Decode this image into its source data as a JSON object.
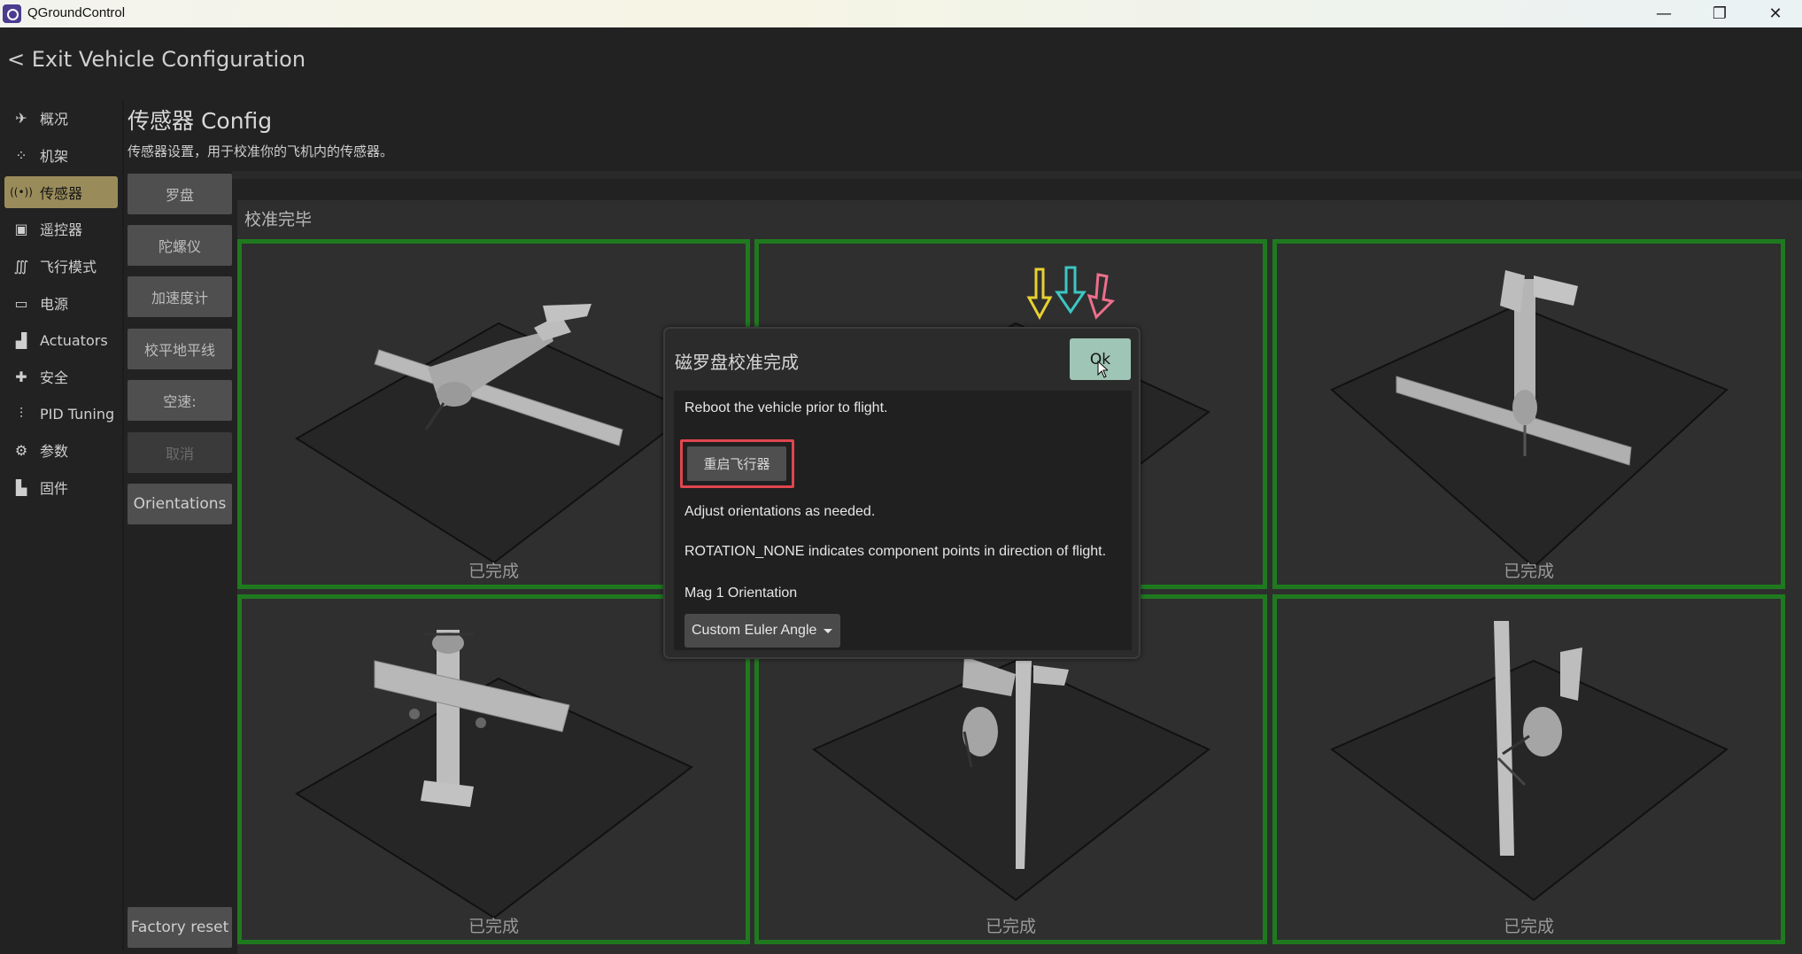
{
  "window": {
    "title": "QGroundControl",
    "minimize_icon": "—",
    "maximize_icon": "❐",
    "close_icon": "✕"
  },
  "header": {
    "exit_label": "< Exit Vehicle Configuration"
  },
  "sidebar": {
    "items": [
      {
        "label": "概况",
        "icon": "paper-plane-icon",
        "glyph": "✈"
      },
      {
        "label": "机架",
        "icon": "airframe-icon",
        "glyph": "⁘"
      },
      {
        "label": "传感器",
        "icon": "radio-waves-icon",
        "glyph": "((•))",
        "active": true
      },
      {
        "label": "遥控器",
        "icon": "gamepad-icon",
        "glyph": "▣"
      },
      {
        "label": "飞行模式",
        "icon": "waveform-icon",
        "glyph": "∭"
      },
      {
        "label": "电源",
        "icon": "battery-icon",
        "glyph": "▭"
      },
      {
        "label": "Actuators",
        "icon": "actuator-icon",
        "glyph": "▟"
      },
      {
        "label": "安全",
        "icon": "medkit-icon",
        "glyph": "✚"
      },
      {
        "label": "PID Tuning",
        "icon": "sliders-icon",
        "glyph": "⫶"
      },
      {
        "label": "参数",
        "icon": "gears-icon",
        "glyph": "⚙"
      },
      {
        "label": "固件",
        "icon": "factory-icon",
        "glyph": "▙"
      }
    ]
  },
  "page": {
    "title": "传感器 Config",
    "description": "传感器设置，用于校准你的飞机内的传感器。",
    "calibration_status": "校准完毕"
  },
  "sensor_buttons": [
    {
      "label": "罗盘",
      "enabled": true
    },
    {
      "label": "陀螺仪",
      "enabled": true
    },
    {
      "label": "加速度计",
      "enabled": true
    },
    {
      "label": "校平地平线",
      "enabled": true
    },
    {
      "label": "空速:",
      "enabled": true
    },
    {
      "label": "取消",
      "enabled": false
    },
    {
      "label": "Orientations",
      "enabled": true
    }
  ],
  "factory_reset_label": "Factory reset",
  "orientation_cells": [
    {
      "name": "level",
      "status": "已完成"
    },
    {
      "name": "upside-down",
      "status": ""
    },
    {
      "name": "nose-down",
      "status": "已完成"
    },
    {
      "name": "tail-down",
      "status": "已完成"
    },
    {
      "name": "right-side",
      "status": "已完成"
    },
    {
      "name": "left-side",
      "status": "已完成"
    }
  ],
  "dialog": {
    "title": "磁罗盘校准完成",
    "ok_label": "Ok",
    "reboot_notice": "Reboot the vehicle prior to flight.",
    "reboot_button": "重启飞行器",
    "adjust_text": "Adjust orientations as needed.",
    "rotation_text": "ROTATION_NONE indicates component points in direction of flight.",
    "mag_label": "Mag 1 Orientation",
    "mag_value": "Custom Euler Angle"
  },
  "colors": {
    "accent_active": "#9a8c5a",
    "cell_border": "#1f7a1f",
    "ok_button": "#9fc5b6",
    "highlight": "#e0464f",
    "arrow_yellow": "#e8d030",
    "arrow_cyan": "#3cc7c4",
    "arrow_pink": "#ec6f8c"
  }
}
